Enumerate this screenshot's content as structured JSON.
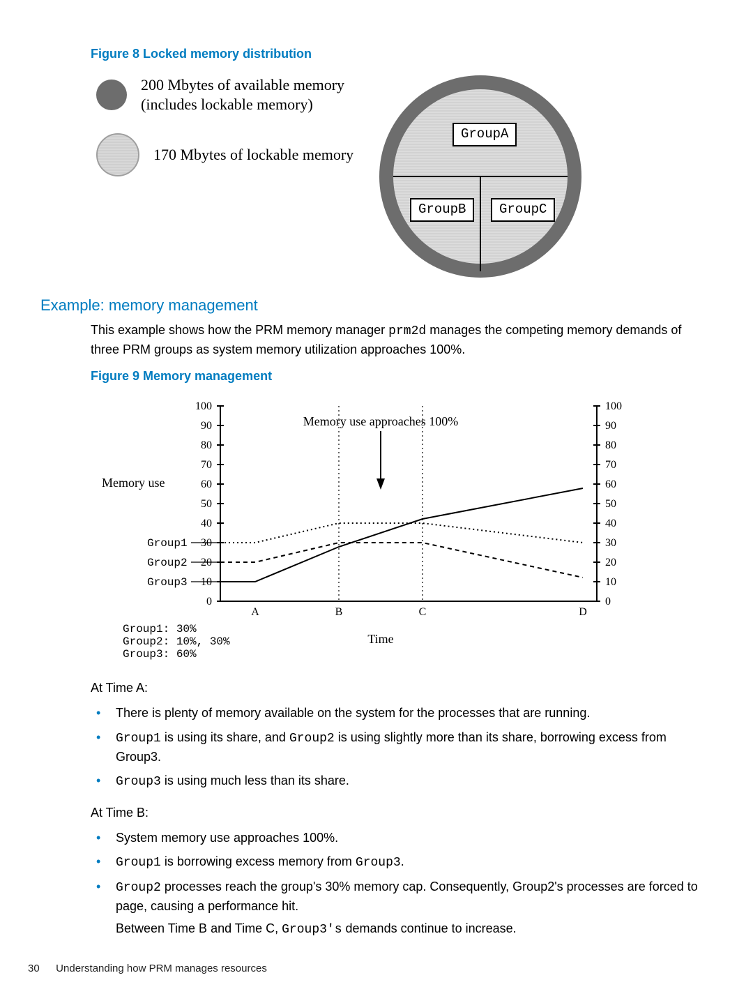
{
  "figure8": {
    "caption": "Figure 8 Locked memory distribution",
    "legend_available": "200 Mbytes of available memory (includes lockable memory)",
    "legend_lockable": "170 Mbytes of lockable memory",
    "groups": {
      "a": "GroupA",
      "b": "GroupB",
      "c": "GroupC"
    }
  },
  "section_heading": "Example: memory management",
  "intro": {
    "p1a": "This example shows how the PRM memory manager ",
    "p1code": "prm2d",
    "p1b": " manages the competing memory demands of three PRM groups as system memory utilization approaches 100%."
  },
  "figure9": {
    "caption": "Figure 9 Memory management",
    "ylabel": "Memory use",
    "xlabel": "Time",
    "anno": "Memory use approaches 100%",
    "series_labels": {
      "g1": "Group1",
      "g2": "Group2",
      "g3": "Group3"
    },
    "shares_lines": {
      "g1": "Group1: 30%",
      "g2": "Group2: 10%, 30%",
      "g3": "Group3: 60%"
    },
    "x_letters": [
      "A",
      "B",
      "C",
      "D"
    ]
  },
  "timeA": {
    "heading": "At Time A:",
    "b1": "There is plenty of memory available on the system for the processes that are running.",
    "b2a": "Group1",
    "b2b": " is using its share, and ",
    "b2c": "Group2",
    "b2d": " is using slightly more than its share, borrowing excess from Group3.",
    "b3a": "Group3",
    "b3b": " is using much less than its share."
  },
  "timeB": {
    "heading": "At Time B:",
    "b1": "System memory use approaches 100%.",
    "b2a": "Group1",
    "b2b": " is borrowing excess memory from ",
    "b2c": "Group3",
    "b2d": ".",
    "b3a": "Group2",
    "b3b": " processes reach the group's 30% memory cap. Consequently, Group2's processes are forced to page, causing a performance hit.",
    "b3c_a": "Between Time B and Time C, ",
    "b3c_code": "Group3's",
    "b3c_b": " demands continue to increase."
  },
  "footer": {
    "page": "30",
    "title": "Understanding how PRM manages resources"
  },
  "chart_data": {
    "type": "line",
    "title": "Memory management",
    "ylabel": "Memory use",
    "xlabel": "Time",
    "ylim": [
      0,
      100
    ],
    "x": [
      "A",
      "B",
      "C",
      "D"
    ],
    "annotation": "Memory use approaches 100%",
    "shares": {
      "Group1": "30%",
      "Group2": "10%, 30%",
      "Group3": "60%"
    },
    "series": [
      {
        "name": "Group1",
        "style": "dotted",
        "values": [
          30,
          40,
          40,
          30
        ]
      },
      {
        "name": "Group2",
        "style": "dashed",
        "values": [
          20,
          30,
          30,
          12
        ]
      },
      {
        "name": "Group3",
        "style": "solid",
        "values": [
          10,
          28,
          42,
          58
        ]
      }
    ]
  }
}
